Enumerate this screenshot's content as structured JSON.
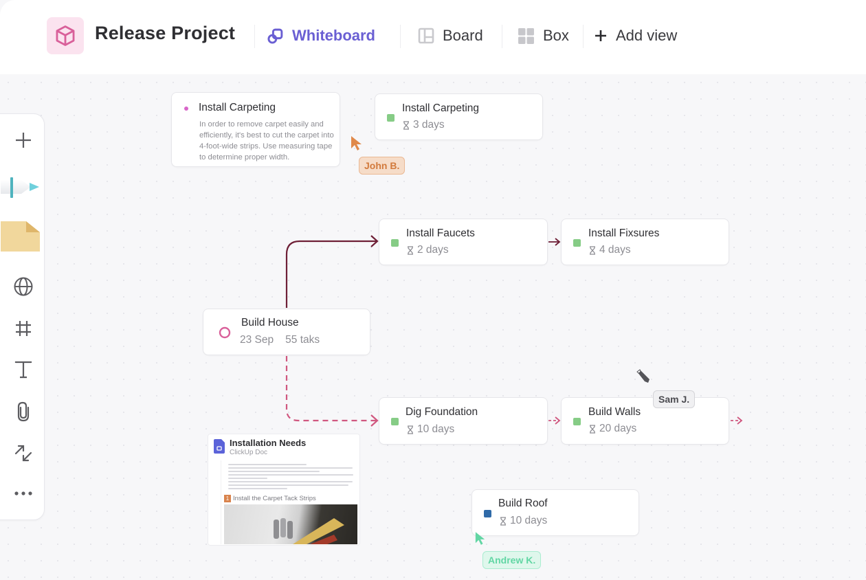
{
  "header": {
    "project_title": "Release Project",
    "project_icon": "cube-icon",
    "project_icon_color": "#d9609a",
    "tabs": [
      {
        "label": "Whiteboard",
        "icon": "whiteboard-icon",
        "active": true
      },
      {
        "label": "Board",
        "icon": "board-icon",
        "active": false
      },
      {
        "label": "Box",
        "icon": "box-grid-icon",
        "active": false
      }
    ],
    "add_view_label": "Add view",
    "accent_color": "#6a5fd3"
  },
  "toolbar": {
    "tools": [
      {
        "name": "add",
        "icon": "plus-icon"
      },
      {
        "name": "pen",
        "icon": "pen-icon"
      },
      {
        "name": "sticky-note",
        "icon": "sticky-note-icon"
      },
      {
        "name": "embed",
        "icon": "globe-icon"
      },
      {
        "name": "frame",
        "icon": "frame-icon"
      },
      {
        "name": "text",
        "icon": "text-icon"
      },
      {
        "name": "attach",
        "icon": "paperclip-icon"
      },
      {
        "name": "connector",
        "icon": "connector-arrows-icon"
      },
      {
        "name": "more",
        "icon": "more-icon"
      }
    ]
  },
  "canvas": {
    "note": {
      "title": "Install Carpeting",
      "body": "In order to remove carpet easily and efficiently, it's best to cut the carpet into 4-foot-wide strips. Use measuring tape to determine proper width."
    },
    "tasks": {
      "install_carpeting": {
        "title": "Install Carpeting",
        "duration": "3 days",
        "status_color": "#86cc86"
      },
      "install_faucets": {
        "title": "Install Faucets",
        "duration": "2 days",
        "status_color": "#86cc86"
      },
      "install_fixsures": {
        "title": "Install Fixsures",
        "duration": "4 days",
        "status_color": "#86cc86"
      },
      "dig_foundation": {
        "title": "Dig Foundation",
        "duration": "10 days",
        "status_color": "#86cc86"
      },
      "build_walls": {
        "title": "Build Walls",
        "duration": "20 days",
        "status_color": "#86cc86"
      },
      "build_roof": {
        "title": "Build Roof",
        "duration": "10 days",
        "status_color": "#2f6aa8"
      }
    },
    "milestone": {
      "title": "Build House",
      "date": "23 Sep",
      "tasks_count": "55 taks",
      "ring_color": "#d9609a"
    },
    "doc": {
      "title": "Installation Needs",
      "subtitle": "ClickUp Doc",
      "step_number": "1",
      "step_title": "Install the Carpet Tack Strips"
    },
    "collaborators": [
      {
        "name": "John B.",
        "color": "#e0894a"
      },
      {
        "name": "Sam J.",
        "color": "#55555a"
      },
      {
        "name": "Andrew K.",
        "color": "#62d6a4"
      }
    ],
    "connector_colors": {
      "solid": "#6e1f36",
      "dashed": "#d0577f"
    }
  }
}
